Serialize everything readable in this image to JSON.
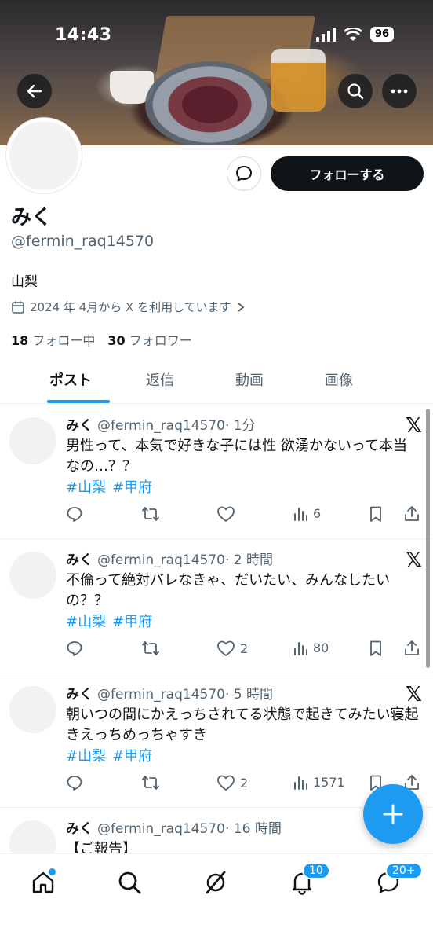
{
  "status_bar": {
    "time": "14:43",
    "battery": "96"
  },
  "profile": {
    "follow_label": "フォローする",
    "name": "みく",
    "handle": "@fermin_raq14570",
    "location": "山梨",
    "joined": "2024 年 4月から X を利用しています",
    "following_count": "18",
    "following_label": "フォロー中",
    "followers_count": "30",
    "followers_label": "フォロワー"
  },
  "tabs": [
    {
      "label": "ポスト",
      "active": true
    },
    {
      "label": "返信"
    },
    {
      "label": "動画"
    },
    {
      "label": "画像"
    }
  ],
  "posts": [
    {
      "author": "みく",
      "handle": "@fermin_raq14570",
      "time": "· 1分",
      "text": "男性って、本気で好きな子には性 欲湧かないって本当なの…？？",
      "hashtags": [
        "#山梨",
        "#甲府"
      ],
      "likes": "",
      "views": "6"
    },
    {
      "author": "みく",
      "handle": "@fermin_raq14570",
      "time": "· 2 時間",
      "text": "不倫って絶対バレなきゃ、だいたい、みんなしたいの？？",
      "hashtags": [
        "#山梨",
        "#甲府"
      ],
      "likes": "2",
      "views": "80"
    },
    {
      "author": "みく",
      "handle": "@fermin_raq14570",
      "time": "· 5 時間",
      "text": "朝いつの間にかえっちされてる状態で起きてみたい寝起きえっちめっちゃすき",
      "hashtags": [
        "#山梨",
        "#甲府"
      ],
      "likes": "2",
      "views": "1571"
    },
    {
      "author": "みく",
      "handle": "@fermin_raq14570",
      "time": "· 16 時間",
      "text": "【ご報告】",
      "hashtags": [],
      "likes": "",
      "views": ""
    }
  ],
  "nav": {
    "notifications_badge": "10",
    "messages_badge": "20+"
  },
  "colors": {
    "accent": "#1d9bf0",
    "text": "#0f1419",
    "muted": "#536471"
  }
}
